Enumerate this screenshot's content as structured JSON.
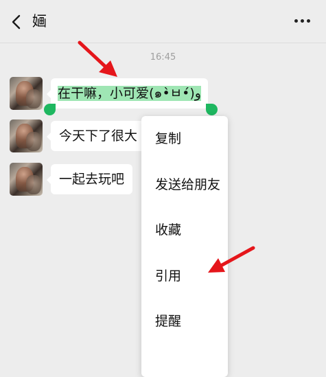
{
  "header": {
    "title": "婳",
    "back_icon": "chevron-left-icon",
    "more_icon": "more-horizontal-icon"
  },
  "timestamp": "16:45",
  "messages": [
    {
      "text": "在干嘛，小可爱(๑•̀ㅂ•́)و",
      "selected": true
    },
    {
      "text": "今天下了很大"
    },
    {
      "text": "一起去玩吧"
    }
  ],
  "context_menu": {
    "items": [
      "复制",
      "发送给朋友",
      "收藏",
      "引用",
      "提醒"
    ]
  },
  "colors": {
    "background": "#ededed",
    "selection": "#9fe6b4",
    "handle": "#1eb760",
    "annotation_arrow": "#e5161b"
  }
}
